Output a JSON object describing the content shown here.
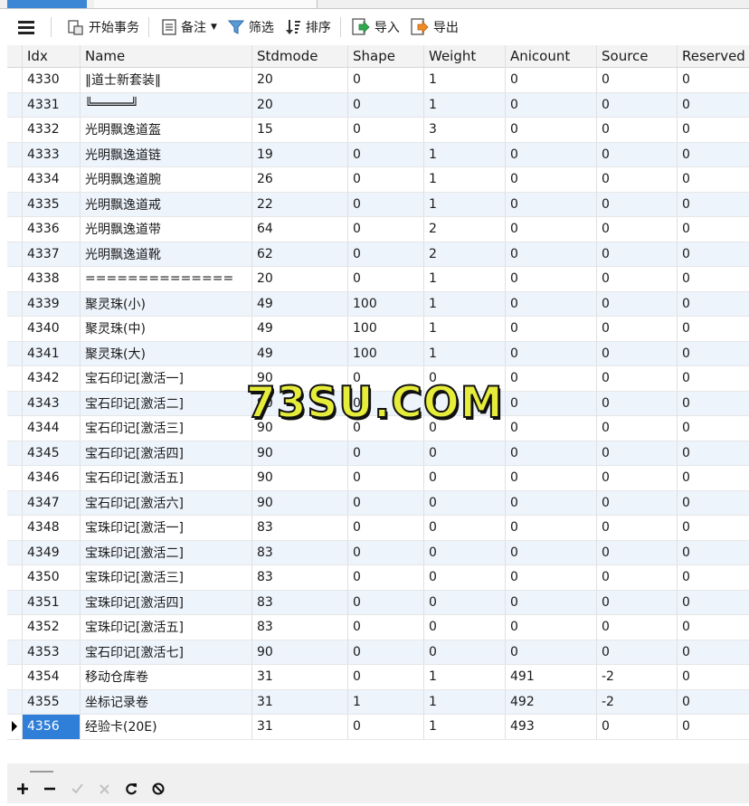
{
  "toolbar": {
    "start_transaction": "开始事务",
    "note": "备注",
    "filter": "筛选",
    "sort": "排序",
    "import": "导入",
    "export": "导出"
  },
  "columns": [
    "Idx",
    "Name",
    "Stdmode",
    "Shape",
    "Weight",
    "Anicount",
    "Source",
    "Reserved"
  ],
  "rows": [
    [
      "4330",
      "‖道士新套装‖",
      "20",
      "0",
      "1",
      "0",
      "0",
      "0"
    ],
    [
      "4331",
      "╚═════╝",
      "20",
      "0",
      "1",
      "0",
      "0",
      "0"
    ],
    [
      "4332",
      "光明飘逸道盔",
      "15",
      "0",
      "3",
      "0",
      "0",
      "0"
    ],
    [
      "4333",
      "光明飘逸道链",
      "19",
      "0",
      "1",
      "0",
      "0",
      "0"
    ],
    [
      "4334",
      "光明飘逸道腕",
      "26",
      "0",
      "1",
      "0",
      "0",
      "0"
    ],
    [
      "4335",
      "光明飘逸道戒",
      "22",
      "0",
      "1",
      "0",
      "0",
      "0"
    ],
    [
      "4336",
      "光明飘逸道带",
      "64",
      "0",
      "2",
      "0",
      "0",
      "0"
    ],
    [
      "4337",
      "光明飘逸道靴",
      "62",
      "0",
      "2",
      "0",
      "0",
      "0"
    ],
    [
      "4338",
      "==============",
      "20",
      "0",
      "1",
      "0",
      "0",
      "0"
    ],
    [
      "4339",
      "聚灵珠(小)",
      "49",
      "100",
      "1",
      "0",
      "0",
      "0"
    ],
    [
      "4340",
      "聚灵珠(中)",
      "49",
      "100",
      "1",
      "0",
      "0",
      "0"
    ],
    [
      "4341",
      "聚灵珠(大)",
      "49",
      "100",
      "1",
      "0",
      "0",
      "0"
    ],
    [
      "4342",
      "宝石印记[激活一]",
      "90",
      "0",
      "0",
      "0",
      "0",
      "0"
    ],
    [
      "4343",
      "宝石印记[激活二]",
      "90",
      "0",
      "0",
      "0",
      "0",
      "0"
    ],
    [
      "4344",
      "宝石印记[激活三]",
      "90",
      "0",
      "0",
      "0",
      "0",
      "0"
    ],
    [
      "4345",
      "宝石印记[激活四]",
      "90",
      "0",
      "0",
      "0",
      "0",
      "0"
    ],
    [
      "4346",
      "宝石印记[激活五]",
      "90",
      "0",
      "0",
      "0",
      "0",
      "0"
    ],
    [
      "4347",
      "宝石印记[激活六]",
      "90",
      "0",
      "0",
      "0",
      "0",
      "0"
    ],
    [
      "4348",
      "宝珠印记[激活一]",
      "83",
      "0",
      "0",
      "0",
      "0",
      "0"
    ],
    [
      "4349",
      "宝珠印记[激活二]",
      "83",
      "0",
      "0",
      "0",
      "0",
      "0"
    ],
    [
      "4350",
      "宝珠印记[激活三]",
      "83",
      "0",
      "0",
      "0",
      "0",
      "0"
    ],
    [
      "4351",
      "宝珠印记[激活四]",
      "83",
      "0",
      "0",
      "0",
      "0",
      "0"
    ],
    [
      "4352",
      "宝珠印记[激活五]",
      "83",
      "0",
      "0",
      "0",
      "0",
      "0"
    ],
    [
      "4353",
      "宝石印记[激活七]",
      "90",
      "0",
      "0",
      "0",
      "0",
      "0"
    ],
    [
      "4354",
      "移动仓库卷",
      "31",
      "0",
      "1",
      "491",
      "-2",
      "0"
    ],
    [
      "4355",
      "坐标记录卷",
      "31",
      "1",
      "1",
      "492",
      "-2",
      "0"
    ],
    [
      "4356",
      "经验卡(20E)",
      "31",
      "0",
      "1",
      "493",
      "0",
      "0"
    ]
  ],
  "current_row_index": 26,
  "watermark": "73SU.COM",
  "colors": {
    "selected": "#2f7ed8",
    "alt_row": "#eef4fc",
    "header": "#f3f3f3"
  }
}
